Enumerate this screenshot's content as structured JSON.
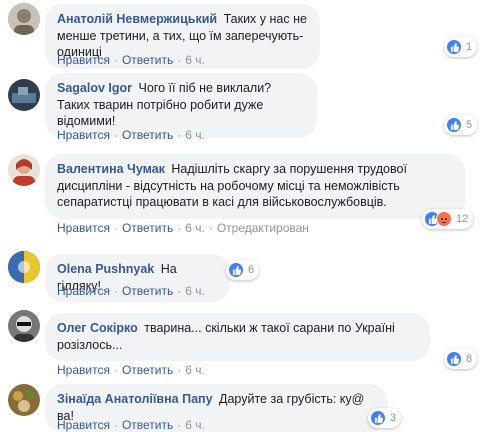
{
  "comments": [
    {
      "author": "Анатолій Невмержицький",
      "text": "Таких у нас не менше третини, а тих, що їм заперечують- одиниці",
      "like_label": "Нравится",
      "reply_label": "Ответить",
      "time": "6 ч.",
      "reactions": [
        "like"
      ],
      "reaction_count": "1",
      "avatar_color": "#b8b0a6"
    },
    {
      "author": "Sagalov Igor",
      "text": "Чого її піб не виклали? Таких тварин потрібно робити дуже відомими!",
      "like_label": "Нравится",
      "reply_label": "Ответить",
      "time": "6 ч.",
      "reactions": [
        "like"
      ],
      "reaction_count": "5",
      "avatar_color": "#3b4d5e"
    },
    {
      "author": "Валентина Чумак",
      "text": "Надішліть скаргу за порушення трудової дисципліни - відсутність на робочому місці та неможлівість сепаратистці працювати в касі для військовослужбовців.",
      "like_label": "Нравится",
      "reply_label": "Ответить",
      "time": "6 ч.",
      "edited": "Отредактирован",
      "reactions": [
        "like",
        "angry"
      ],
      "reaction_count": "12",
      "avatar_color": "#c0392b"
    },
    {
      "author": "Olena Pushnyak",
      "text": "На гілляку!",
      "like_label": "Нравится",
      "reply_label": "Ответить",
      "time": "6 ч.",
      "reactions": [
        "like"
      ],
      "reaction_count": "6",
      "avatar_color": "#2c4a7a"
    },
    {
      "author": "Олег Сокірко",
      "text": "тварина... скільки ж такої сарани по Україні розізлось...",
      "like_label": "Нравится",
      "reply_label": "Ответить",
      "time": "6 ч.",
      "reactions": [
        "like"
      ],
      "reaction_count": "8",
      "avatar_color": "#444"
    },
    {
      "author": "Зінаїда Анатоліївна Папу",
      "text": "Даруйте за грубість: ку@ ва!",
      "like_label": "Нравится",
      "reply_label": "Ответить",
      "time": "6 ч.",
      "reactions": [
        "like"
      ],
      "reaction_count": "3",
      "avatar_color": "#8a6b3a"
    }
  ],
  "colors": {
    "link": "#385898",
    "bubble": "#f2f3f5",
    "meta": "#90949c",
    "like": "#4080ff",
    "angry": "#f7714b"
  }
}
